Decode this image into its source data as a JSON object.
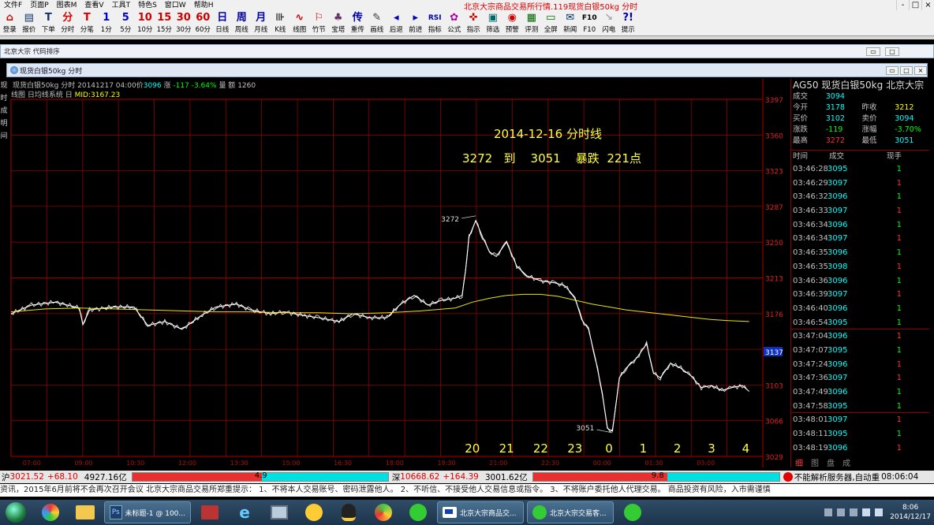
{
  "menu": {
    "items": [
      "文件F",
      "页面P",
      "图表M",
      "查看V",
      "工具T",
      "特色S",
      "窗口W",
      "帮助H"
    ],
    "app_title": "北京大宗商品交易所行情.119现货白银50kg 分时"
  },
  "window_controls": [
    "-",
    "□",
    "×"
  ],
  "toolbar": [
    {
      "icon": "⌂",
      "label": "登录",
      "color": "#c00"
    },
    {
      "icon": "▤",
      "label": "报价",
      "color": "#136"
    },
    {
      "icon": "T",
      "label": "下单",
      "color": "#136"
    },
    {
      "icon": "分",
      "label": "分时",
      "color": "#d00"
    },
    {
      "icon": "T",
      "label": "分笔",
      "color": "#d00"
    },
    {
      "icon": "1",
      "label": "1分",
      "color": "#00c"
    },
    {
      "icon": "5",
      "label": "5分",
      "color": "#00c"
    },
    {
      "icon": "10",
      "label": "10分",
      "color": "#c00"
    },
    {
      "icon": "15",
      "label": "15分",
      "color": "#c00"
    },
    {
      "icon": "30",
      "label": "30分",
      "color": "#c00"
    },
    {
      "icon": "60",
      "label": "60分",
      "color": "#c00"
    },
    {
      "icon": "日",
      "label": "日线",
      "color": "#00a"
    },
    {
      "icon": "周",
      "label": "周线",
      "color": "#00a"
    },
    {
      "icon": "月",
      "label": "月线",
      "color": "#00a"
    },
    {
      "icon": "⊪",
      "label": "K线",
      "color": "#333"
    },
    {
      "icon": "∿",
      "label": "线图",
      "color": "#c00"
    },
    {
      "icon": "⚐",
      "label": "竹节",
      "color": "#c00"
    },
    {
      "icon": "♣",
      "label": "宝塔",
      "color": "#636"
    },
    {
      "icon": "传",
      "label": "重传",
      "color": "#00a"
    },
    {
      "icon": "✎",
      "label": "画线",
      "color": "#333"
    },
    {
      "icon": "◂",
      "label": "后退",
      "color": "#00a"
    },
    {
      "icon": "▸",
      "label": "前进",
      "color": "#00a"
    },
    {
      "icon": "RSI",
      "label": "指标",
      "color": "#00a"
    },
    {
      "icon": "✿",
      "label": "公式",
      "color": "#a0a"
    },
    {
      "icon": "✜",
      "label": "指示",
      "color": "#c00"
    },
    {
      "icon": "▣",
      "label": "筛选",
      "color": "#066"
    },
    {
      "icon": "◉",
      "label": "预警",
      "color": "#c00"
    },
    {
      "icon": "▦",
      "label": "评测",
      "color": "#060"
    },
    {
      "icon": "▭",
      "label": "全屏",
      "color": "#060"
    },
    {
      "icon": "✉",
      "label": "新闻",
      "color": "#036"
    },
    {
      "icon": "F10",
      "label": "F10",
      "color": "#000"
    },
    {
      "icon": "↘",
      "label": "闪电",
      "color": "#aaa"
    },
    {
      "icon": "?!",
      "label": "提示",
      "color": "#00a"
    }
  ],
  "outer_window": {
    "title": "北京大宗 代码排序",
    "controls": [
      "▭",
      "□"
    ]
  },
  "inner_window": {
    "title": "现货白银50kg 分时",
    "controls": [
      "▭",
      "□",
      "×"
    ]
  },
  "left_strip": [
    "现",
    "时",
    "成",
    "明",
    "间"
  ],
  "chart_info": {
    "line1_name": "现货白银50kg 分时",
    "line1_date": "20141217 04:00价",
    "line1_price": "3096",
    "line1_change_label": "涨",
    "line1_change": "-117",
    "line1_pct": "-3.64%",
    "line1_vol_label": "量 额",
    "line1_vol": "1260",
    "line2_text": "线图 日均线系统 日",
    "line2_mid": "MID:3167.23"
  },
  "annotation": {
    "title": "2014-12-16  分时线",
    "subtitle": "3272   到    3051    暴跌  221点",
    "high_label": "3272",
    "low_label": "3051",
    "current_price_box": "3137"
  },
  "chart_data": {
    "type": "line",
    "title": "",
    "xlabel": "",
    "ylabel": "",
    "ylim": [
      3029,
      3397
    ],
    "ytick_labels": [
      3397,
      3360,
      3323,
      3287,
      3250,
      3213,
      3176,
      3139,
      3103,
      3066,
      3029
    ],
    "hour_labels": [
      "20",
      "21",
      "22",
      "23",
      "0",
      "1",
      "2",
      "3",
      "4"
    ],
    "hour_positions": [
      20.5,
      21.5,
      22.5,
      23.5,
      24.5,
      25.5,
      26.5,
      27.5,
      28.5
    ],
    "xlim": [
      7,
      29
    ],
    "x_tick_labels": [
      "07:00",
      "09:00",
      "10:30",
      "12:00",
      "13:30",
      "15:00",
      "16:30",
      "18:00",
      "19:30",
      "21:00",
      "22:30",
      "00:00",
      "01:30",
      "03:00"
    ],
    "series": [
      {
        "color": "#ffffff",
        "x": [
          7.0,
          7.6,
          8.3,
          9.0,
          9.1,
          9.3,
          10.0,
          10.6,
          11.0,
          11.5,
          12.0,
          12.6,
          13.0,
          13.6,
          14.0,
          14.6,
          15.0,
          15.6,
          16.0,
          16.6,
          17.0,
          17.5,
          18.0,
          18.4,
          18.8,
          19.2,
          19.6,
          20.0,
          20.2,
          20.3,
          20.4,
          20.6,
          20.8,
          21.0,
          21.2,
          21.5,
          21.8,
          22.1,
          22.5,
          22.9,
          23.2,
          23.5,
          23.7,
          23.9,
          24.1,
          24.3,
          24.45,
          24.6,
          24.8,
          25.0,
          25.3,
          25.6,
          25.8,
          26.0,
          26.3,
          26.6,
          26.9,
          27.2,
          27.5,
          27.8,
          28.1,
          28.4,
          28.6
        ],
        "y": [
          3176,
          3185,
          3188,
          3182,
          3165,
          3180,
          3183,
          3183,
          3164,
          3168,
          3160,
          3175,
          3183,
          3186,
          3180,
          3176,
          3178,
          3174,
          3172,
          3168,
          3176,
          3172,
          3172,
          3186,
          3195,
          3185,
          3190,
          3192,
          3195,
          3220,
          3255,
          3272,
          3255,
          3240,
          3235,
          3250,
          3225,
          3215,
          3210,
          3208,
          3205,
          3193,
          3170,
          3160,
          3130,
          3095,
          3058,
          3055,
          3110,
          3120,
          3130,
          3145,
          3115,
          3110,
          3125,
          3120,
          3112,
          3100,
          3102,
          3097,
          3100,
          3102,
          3096
        ]
      },
      {
        "color": "#e8e800",
        "x": [
          7.0,
          8.0,
          9.0,
          10.0,
          11.0,
          12.0,
          13.0,
          14.0,
          15.0,
          16.0,
          17.0,
          18.0,
          19.0,
          20.0,
          20.5,
          21.0,
          21.5,
          22.0,
          22.5,
          23.0,
          23.5,
          24.0,
          24.5,
          25.0,
          25.5,
          26.0,
          26.5,
          27.0,
          27.5,
          28.0,
          28.6
        ],
        "y": [
          3178,
          3181,
          3182,
          3181,
          3180,
          3179,
          3178,
          3178,
          3177,
          3177,
          3176,
          3177,
          3179,
          3182,
          3188,
          3192,
          3195,
          3196,
          3196,
          3194,
          3190,
          3186,
          3183,
          3180,
          3178,
          3176,
          3174,
          3172,
          3170,
          3169,
          3168
        ]
      }
    ]
  },
  "quote_panel": {
    "code": "AG50",
    "name": "现货白银50kg",
    "exchange": "北京大宗",
    "rows": [
      {
        "label": "成交",
        "value": "3094",
        "color": "#00ffff",
        "label2": "",
        "value2": "",
        "color2": "#00ffff"
      },
      {
        "label": "今开",
        "value": "3178",
        "color": "#00ffff",
        "label2": "昨收",
        "value2": "3212",
        "color2": "#ffff00"
      },
      {
        "label": "买价",
        "value": "3102",
        "color": "#00ffff",
        "label2": "卖价",
        "value2": "3094",
        "color2": "#00ffff"
      },
      {
        "label": "涨跌",
        "value": "-119",
        "color": "#00ff00",
        "label2": "涨幅",
        "value2": "-3.70%",
        "color2": "#00ff00"
      },
      {
        "label": "最高",
        "value": "3272",
        "color": "#ff3030",
        "label2": "最低",
        "value2": "3051",
        "color2": "#00ffff"
      }
    ]
  },
  "ticks": {
    "headers": [
      "时间",
      "成交",
      "现手"
    ],
    "rows": [
      {
        "time": "03:46:28",
        "price": "3095",
        "vol": "1",
        "vcolor": "#00ff00"
      },
      {
        "time": "03:46:29",
        "price": "3097",
        "vol": "1",
        "vcolor": "#ff3030"
      },
      {
        "time": "03:46:32",
        "price": "3096",
        "vol": "1",
        "vcolor": "#00ff00"
      },
      {
        "time": "03:46:33",
        "price": "3097",
        "vol": "1",
        "vcolor": "#ff3030"
      },
      {
        "time": "03:46:34",
        "price": "3096",
        "vol": "1",
        "vcolor": "#00ff00"
      },
      {
        "time": "03:46:34",
        "price": "3097",
        "vol": "1",
        "vcolor": "#ff3030"
      },
      {
        "time": "03:46:35",
        "price": "3096",
        "vol": "1",
        "vcolor": "#00ff00"
      },
      {
        "time": "03:46:35",
        "price": "3098",
        "vol": "1",
        "vcolor": "#ff3030"
      },
      {
        "time": "03:46:36",
        "price": "3096",
        "vol": "1",
        "vcolor": "#00ff00"
      },
      {
        "time": "03:46:39",
        "price": "3097",
        "vol": "1",
        "vcolor": "#ff3030"
      },
      {
        "time": "03:46:40",
        "price": "3096",
        "vol": "1",
        "vcolor": "#00ff00"
      },
      {
        "time": "03:46:54",
        "price": "3095",
        "vol": "1",
        "vcolor": "#00ff00"
      },
      {
        "time": "03:47:04",
        "price": "3096",
        "vol": "1",
        "vcolor": "#ff3030"
      },
      {
        "time": "03:47:07",
        "price": "3095",
        "vol": "1",
        "vcolor": "#00ff00"
      },
      {
        "time": "03:47:24",
        "price": "3096",
        "vol": "1",
        "vcolor": "#ff3030"
      },
      {
        "time": "03:47:36",
        "price": "3097",
        "vol": "1",
        "vcolor": "#ff3030"
      },
      {
        "time": "03:47:49",
        "price": "3096",
        "vol": "1",
        "vcolor": "#00ff00"
      },
      {
        "time": "03:47:58",
        "price": "3095",
        "vol": "1",
        "vcolor": "#00ff00"
      },
      {
        "time": "03:48:01",
        "price": "3097",
        "vol": "1",
        "vcolor": "#ff3030"
      },
      {
        "time": "03:48:11",
        "price": "3095",
        "vol": "1",
        "vcolor": "#00ff00"
      },
      {
        "time": "03:48:19",
        "price": "3096",
        "vol": "1",
        "vcolor": "#ff3030"
      }
    ],
    "tabs": [
      "细",
      "图",
      "盘",
      "成"
    ]
  },
  "status": {
    "sh_label": "沪",
    "sh_index": "3021.52",
    "sh_change": "+68.10",
    "sh_amount": "4927.16亿",
    "sh_bar_value": "4.9",
    "sz_label": "深",
    "sz_index": "10668.62",
    "sz_change": "+164.39",
    "sz_amount": "3001.62亿",
    "sz_bar_value": "9.8",
    "server_msg": "不能解析服务器,自动重",
    "time": "08:06:04"
  },
  "ticker": "资讯，2015年6月前将不会再次召开会议   北京大宗商品交易所郑重提示：  1、不将本人交易账号、密码泄露他人。    2、不听信、不接受他人交易信息或指令。    3、不将账户委托他人代理交易。    商品投资有风险，入市需谨慎",
  "taskbar": {
    "windows": [
      {
        "label": "未标题-1 @ 100..."
      },
      {
        "label": "北京大宗商品交..."
      },
      {
        "label": "北京大宗交易客..."
      }
    ],
    "clock_time": "8:06",
    "clock_date": "2014/12/17"
  }
}
